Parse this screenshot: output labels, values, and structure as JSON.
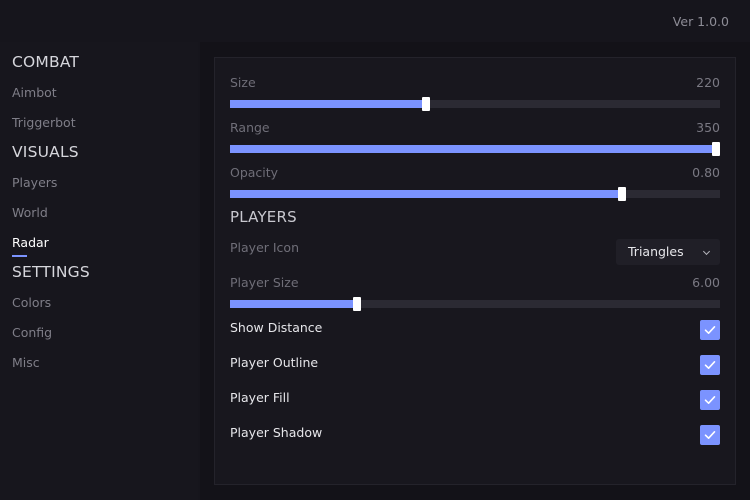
{
  "header": {
    "version": "Ver 1.0.0"
  },
  "sidebar": {
    "sections": [
      {
        "title": "COMBAT",
        "items": [
          "Aimbot",
          "Triggerbot"
        ]
      },
      {
        "title": "VISUALS",
        "items": [
          "Players",
          "World",
          "Radar"
        ]
      },
      {
        "title": "SETTINGS",
        "items": [
          "Colors",
          "Config",
          "Misc"
        ]
      }
    ],
    "active_item": "Radar"
  },
  "panel": {
    "sliders": [
      {
        "label": "Size",
        "value": "220",
        "fraction": 0.4
      },
      {
        "label": "Range",
        "value": "350",
        "fraction": 1.0
      },
      {
        "label": "Opacity",
        "value": "0.80",
        "fraction": 0.8
      }
    ],
    "players_section": {
      "title": "PLAYERS",
      "player_icon": {
        "label": "Player Icon",
        "selected": "Triangles"
      },
      "player_size": {
        "label": "Player Size",
        "value": "6.00",
        "fraction": 0.26
      },
      "checkboxes": [
        {
          "label": "Show Distance",
          "checked": true
        },
        {
          "label": "Player Outline",
          "checked": true
        },
        {
          "label": "Player Fill",
          "checked": true
        },
        {
          "label": "Player Shadow",
          "checked": true
        }
      ]
    }
  },
  "colors": {
    "accent": "#7b93ff",
    "background": "#16151c",
    "panel": "#18171e",
    "track": "#2b2a33"
  }
}
